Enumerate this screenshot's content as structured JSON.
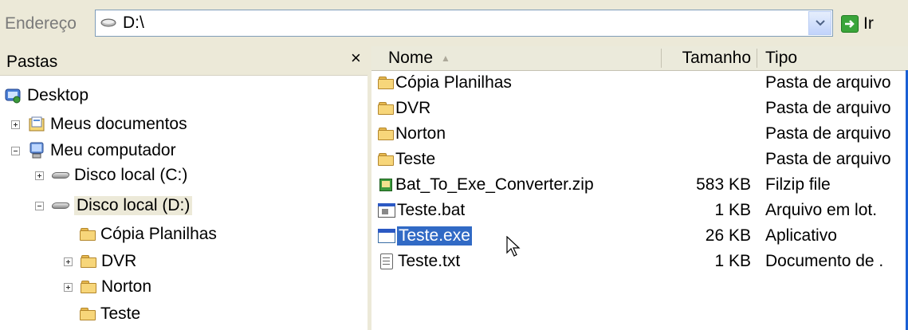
{
  "address_bar": {
    "label": "Endereço",
    "value": "D:\\",
    "go_label": "Ir"
  },
  "folders_panel": {
    "title": "Pastas",
    "close_glyph": "×",
    "items": [
      {
        "label": "Desktop",
        "icon": "desktop-icon"
      },
      {
        "label": "Meus documentos",
        "icon": "my-documents-icon",
        "expander": "+"
      },
      {
        "label": "Meu computador",
        "icon": "my-computer-icon",
        "expander": "-"
      },
      {
        "label": "Disco local (C:)",
        "icon": "drive-icon",
        "expander": "+"
      },
      {
        "label": "Disco local (D:)",
        "icon": "drive-icon",
        "expander": "-",
        "selected": true
      },
      {
        "label": "Cópia Planilhas",
        "icon": "folder-icon"
      },
      {
        "label": "DVR",
        "icon": "folder-icon",
        "expander": "+"
      },
      {
        "label": "Norton",
        "icon": "folder-icon",
        "expander": "+"
      },
      {
        "label": "Teste",
        "icon": "folder-icon"
      }
    ]
  },
  "file_list": {
    "columns": {
      "name": "Nome",
      "size": "Tamanho",
      "type": "Tipo"
    },
    "rows": [
      {
        "name": "Cópia Planilhas",
        "size": "",
        "type": "Pasta de arquivo",
        "icon": "folder-icon"
      },
      {
        "name": "DVR",
        "size": "",
        "type": "Pasta de arquivo",
        "icon": "folder-icon"
      },
      {
        "name": "Norton",
        "size": "",
        "type": "Pasta de arquivo",
        "icon": "folder-icon"
      },
      {
        "name": "Teste",
        "size": "",
        "type": "Pasta de arquivo",
        "icon": "folder-icon"
      },
      {
        "name": "Bat_To_Exe_Converter.zip",
        "size": "583 KB",
        "type": "Filzip file",
        "icon": "zip-icon"
      },
      {
        "name": "Teste.bat",
        "size": "1 KB",
        "type": "Arquivo em lot.",
        "icon": "bat-icon"
      },
      {
        "name": "Teste.exe",
        "size": "26 KB",
        "type": "Aplicativo",
        "icon": "exe-icon",
        "selected": true
      },
      {
        "name": "Teste.txt",
        "size": "1 KB",
        "type": "Documento de .",
        "icon": "txt-icon"
      }
    ]
  },
  "colors": {
    "selection": "#316ac5",
    "toolbar_bg": "#ece9d8"
  }
}
